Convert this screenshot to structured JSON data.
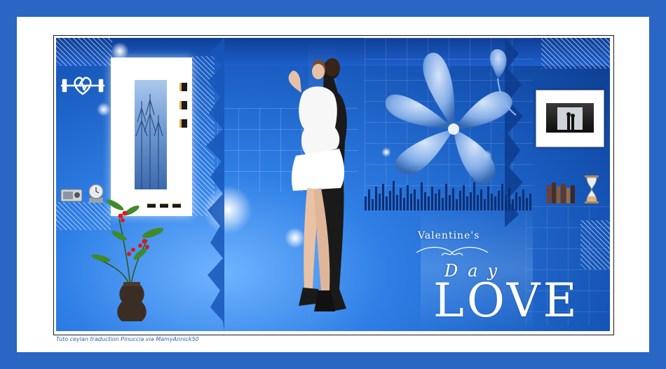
{
  "valentine": {
    "title": "Valentine's",
    "day": "Day",
    "love": "LOVE"
  },
  "credit": {
    "text": "Tuto ceylan traduction Pinuccia via MamyAnnick50"
  },
  "colors": {
    "outer_border": "#2a66c4",
    "inner_frame": "#ffffff",
    "scene_blue": "#1656b8",
    "accent_gold": "#e3b04b",
    "credit_text": "#2a5fb8"
  },
  "icons": [
    "heart-dumbbell-icon",
    "radio-icon",
    "clock-icon",
    "books-icon",
    "hourglass-icon",
    "vase-plant-icon"
  ]
}
